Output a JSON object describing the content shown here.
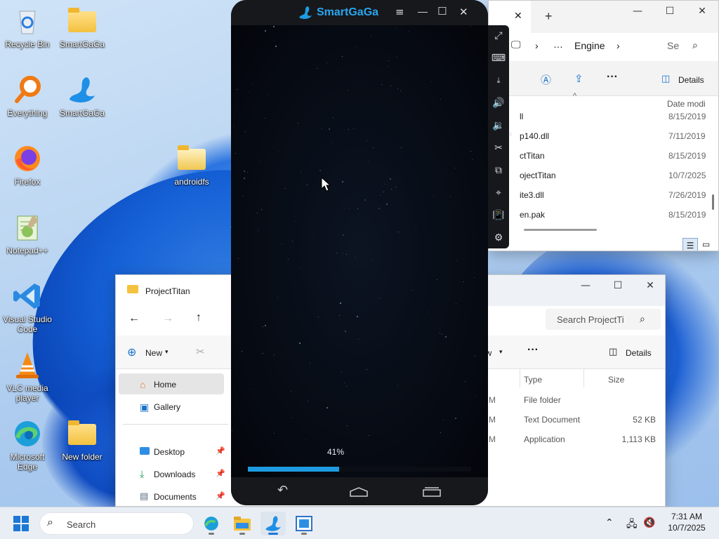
{
  "desktop": {
    "icons": [
      {
        "label": "Recycle Bin"
      },
      {
        "label": "SmartGaGa"
      },
      {
        "label": "Everything"
      },
      {
        "label": "SmartGaGa"
      },
      {
        "label": "Firefox"
      },
      {
        "label": "androidfs"
      },
      {
        "label": "Notepad++"
      },
      {
        "label": "Visual Studio Code"
      },
      {
        "label": "VLC media player"
      },
      {
        "label": "Microsoft Edge"
      },
      {
        "label": "New folder"
      }
    ]
  },
  "emulator": {
    "title": "SmartGaGa",
    "progress_label": "41%",
    "progress": 0.41,
    "accent": "#1e9be0"
  },
  "explorer_top": {
    "breadcrumb_more": "…",
    "breadcrumb": "Engine",
    "search_placeholder": "Se",
    "details_label": "Details",
    "sort_caret": "^",
    "column_date": "Date modi",
    "rows": [
      {
        "name": "ll",
        "date": "8/15/2019"
      },
      {
        "name": "p140.dll",
        "date": "7/11/2019"
      },
      {
        "name": "ctTitan",
        "date": "8/15/2019"
      },
      {
        "name": "ojectTitan",
        "date": "10/7/2025"
      },
      {
        "name": "ite3.dll",
        "date": "7/26/2019"
      },
      {
        "name": "en.pak",
        "date": "8/15/2019"
      }
    ]
  },
  "explorer_bottom": {
    "tab_title": "ProjectTitan",
    "search_placeholder": "Search ProjectTi",
    "new_label": "New",
    "view_label": "ew",
    "details_label": "Details",
    "nav": {
      "home": "Home",
      "gallery": "Gallery",
      "desktop": "Desktop",
      "downloads": "Downloads",
      "documents": "Documents"
    },
    "columns": {
      "type": "Type",
      "size": "Size"
    },
    "rows": [
      {
        "m": "M",
        "type": "File folder",
        "size": ""
      },
      {
        "m": "M",
        "type": "Text Document",
        "size": "52 KB"
      },
      {
        "m": "M",
        "type": "Application",
        "size": "1,113 KB"
      }
    ]
  },
  "taskbar": {
    "search_label": "Search",
    "time": "7:31 AM",
    "date": "10/7/2025"
  }
}
